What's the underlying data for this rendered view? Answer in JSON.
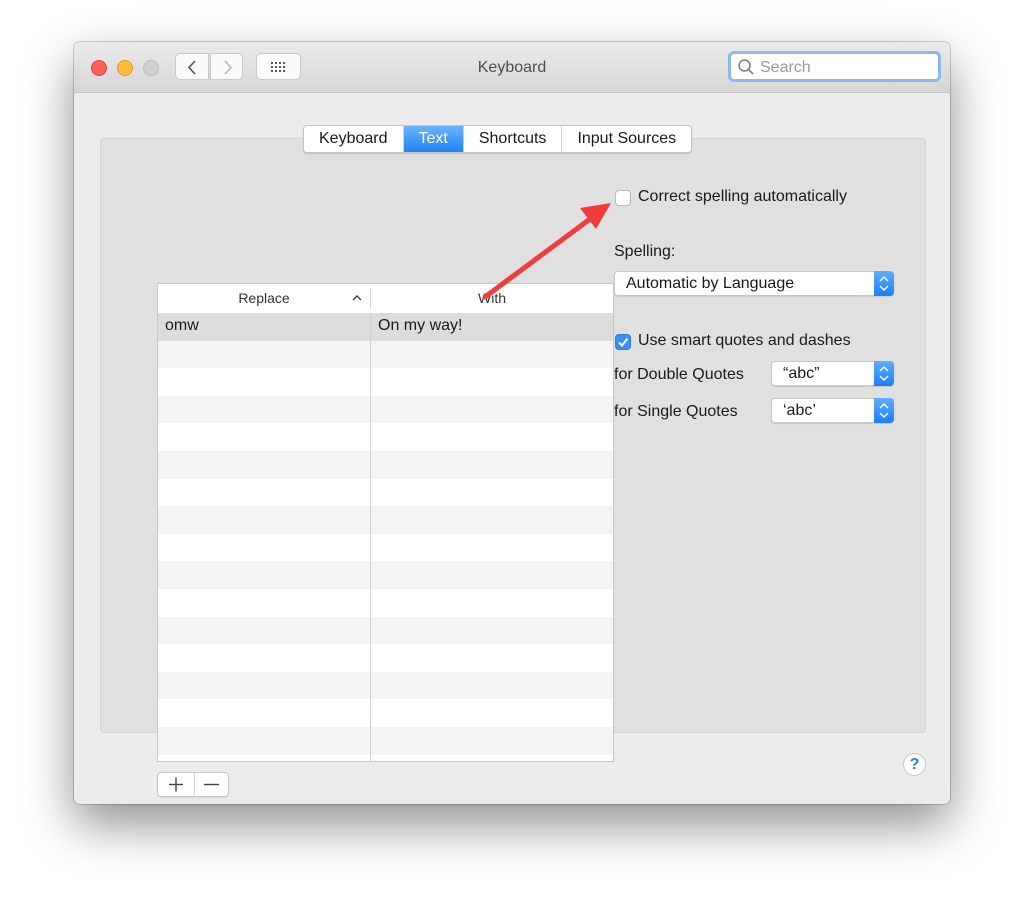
{
  "window": {
    "title": "Keyboard",
    "search": {
      "placeholder": "Search",
      "value": ""
    }
  },
  "tabs": [
    {
      "label": "Keyboard",
      "active": false
    },
    {
      "label": "Text",
      "active": true
    },
    {
      "label": "Shortcuts",
      "active": false
    },
    {
      "label": "Input Sources",
      "active": false
    }
  ],
  "table": {
    "columns": [
      "Replace",
      "With"
    ],
    "sort_column": "Replace",
    "sort_direction": "ascending",
    "rows": [
      {
        "replace": "omw",
        "with": "On my way!",
        "selected": true
      }
    ],
    "add_label": "+",
    "remove_label": "−"
  },
  "options": {
    "correct_spelling": {
      "label": "Correct spelling automatically",
      "checked": false
    },
    "spelling_label": "Spelling:",
    "spelling_value": "Automatic by Language",
    "smart_quotes": {
      "label": "Use smart quotes and dashes",
      "checked": true
    },
    "double_quotes_label": "for Double Quotes",
    "double_quotes_value": "“abc”",
    "single_quotes_label": "for Single Quotes",
    "single_quotes_value": "‘abc’"
  },
  "help_label": "?",
  "annotation": {
    "type": "arrow",
    "color": "#f33b3b",
    "points_to": "correct-spelling-checkbox"
  }
}
